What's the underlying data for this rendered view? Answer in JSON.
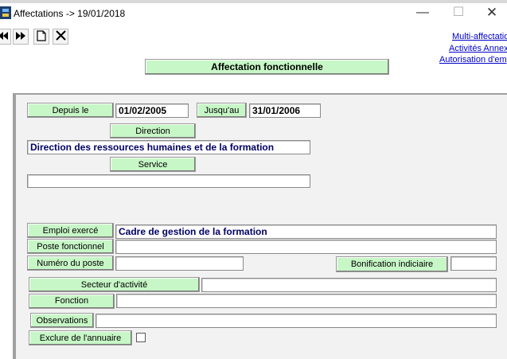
{
  "window": {
    "title": "Affectations -> 19/01/2018",
    "minimize_glyph": "—",
    "maximize_glyph": "☐",
    "close_glyph": "✕"
  },
  "toolbar": {
    "first_glyph": "⏮",
    "next_glyph": "⏭",
    "new_glyph": "🗋",
    "delete_glyph": "✕"
  },
  "links": {
    "multi_affectation": "Multi-affectation",
    "activites_annexes": "Activités Annex",
    "autorisation": "Autorisation d'emp"
  },
  "section_title": "Affectation fonctionnelle",
  "form": {
    "depuis_label": "Depuis le",
    "depuis_value": "01/02/2005",
    "jusqu_label": "Jusqu'au",
    "jusqu_value": "31/01/2006",
    "direction_label": "Direction",
    "direction_value": "Direction des ressources humaines et de la formation",
    "service_label": "Service",
    "service_value": "",
    "emploi_label": "Emploi exercé",
    "emploi_value": "Cadre de gestion de la formation",
    "poste_label": "Poste fonctionnel",
    "poste_value": "",
    "numero_label": "Numéro du poste",
    "numero_value": "",
    "bonification_label": "Bonification indiciaire",
    "bonification_value": "",
    "secteur_label": "Secteur d'activité",
    "secteur_value": "",
    "fonction_label": "Fonction",
    "fonction_value": "",
    "observations_label": "Observations",
    "observations_value": "",
    "exclure_label": "Exclure de l'annuaire",
    "exclure_checked": false
  },
  "icons": [
    "app-icon",
    "first-record-icon",
    "next-record-icon",
    "new-document-icon",
    "delete-icon"
  ],
  "colors": {
    "label_green": "#c7f7c6",
    "field_text_navy": "#000064",
    "link_blue": "#0000cc",
    "panel_bg": "#f2f2f2"
  }
}
